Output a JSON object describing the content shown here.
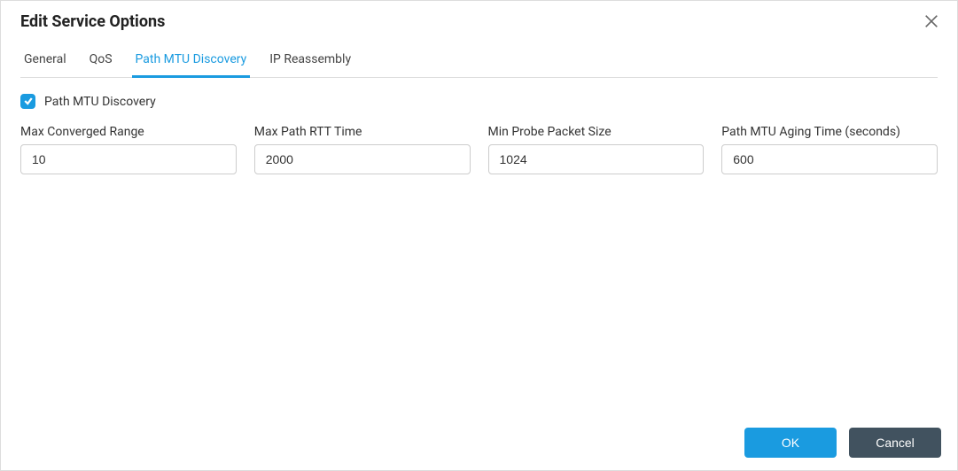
{
  "dialog": {
    "title": "Edit Service Options"
  },
  "tabs": [
    {
      "label": "General",
      "active": false
    },
    {
      "label": "QoS",
      "active": false
    },
    {
      "label": "Path MTU Discovery",
      "active": true
    },
    {
      "label": "IP Reassembly",
      "active": false
    }
  ],
  "pathMtu": {
    "checkbox_label": "Path MTU Discovery",
    "checked": true,
    "fields": {
      "maxConvergedRange": {
        "label": "Max Converged Range",
        "value": "10"
      },
      "maxPathRttTime": {
        "label": "Max Path RTT Time",
        "value": "2000"
      },
      "minProbePacketSize": {
        "label": "Min Probe Packet Size",
        "value": "1024"
      },
      "pathMtuAgingTime": {
        "label": "Path MTU Aging Time (seconds)",
        "value": "600"
      }
    }
  },
  "footer": {
    "ok_label": "OK",
    "cancel_label": "Cancel"
  }
}
